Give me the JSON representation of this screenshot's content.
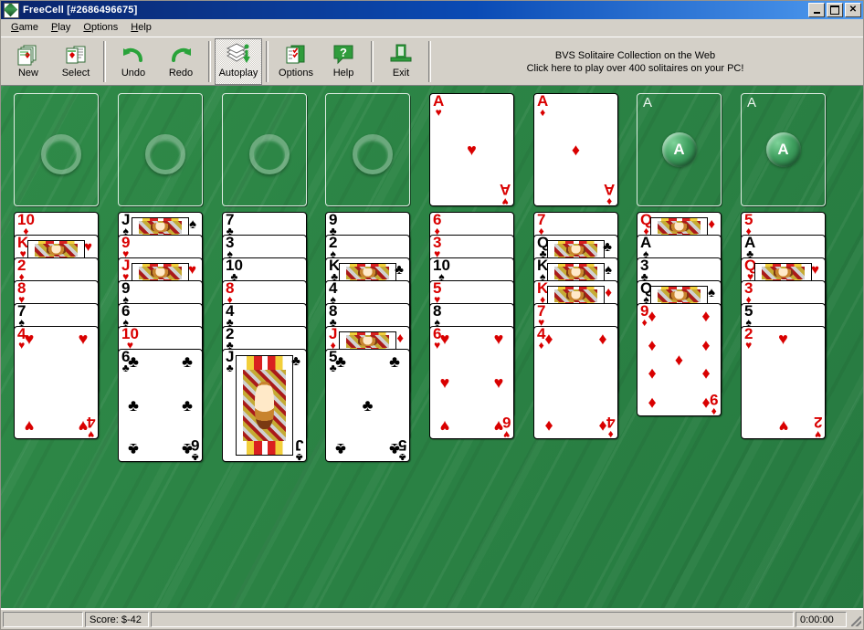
{
  "window": {
    "title": "FreeCell [#2686496675]",
    "icon": "cards-icon",
    "buttons": {
      "minimize": "minimize-icon",
      "maximize": "maximize-icon",
      "close": "✕"
    }
  },
  "menu": {
    "items": [
      "Game",
      "Play",
      "Options",
      "Help"
    ]
  },
  "toolbar": {
    "buttons": [
      {
        "label": "New",
        "icon": "new-game-icon",
        "active": false
      },
      {
        "label": "Select",
        "icon": "select-game-icon",
        "active": false
      },
      {
        "label": "Undo",
        "icon": "undo-icon",
        "active": false
      },
      {
        "label": "Redo",
        "icon": "redo-icon",
        "active": false
      },
      {
        "label": "Autoplay",
        "icon": "autoplay-icon",
        "active": true
      },
      {
        "label": "Options",
        "icon": "options-icon",
        "active": false
      },
      {
        "label": "Help",
        "icon": "help-icon",
        "active": false
      },
      {
        "label": "Exit",
        "icon": "exit-icon",
        "active": false
      }
    ],
    "ad_line1": "BVS Solitaire Collection on the Web",
    "ad_line2": "Click here to play over 400 solitaires on your PC!"
  },
  "board": {
    "background_color": "#2f8a48",
    "free_cells": [
      {
        "empty": true,
        "placeholder": "ring"
      },
      {
        "empty": true,
        "placeholder": "ring"
      },
      {
        "empty": true,
        "placeholder": "ring"
      },
      {
        "empty": true,
        "placeholder": "ring"
      },
      {
        "empty": false,
        "rank": "A",
        "suit": "♥",
        "color": "red"
      },
      {
        "empty": false,
        "rank": "A",
        "suit": "♦",
        "color": "red"
      }
    ],
    "foundations": [
      {
        "empty": true,
        "corner_label": "A",
        "orb_label": "A"
      },
      {
        "empty": true,
        "corner_label": "A",
        "orb_label": "A"
      }
    ],
    "tableau": [
      [
        {
          "rank": "10",
          "suit": "♦",
          "color": "red"
        },
        {
          "rank": "K",
          "suit": "♥",
          "color": "red",
          "court": true
        },
        {
          "rank": "2",
          "suit": "♦",
          "color": "red"
        },
        {
          "rank": "8",
          "suit": "♥",
          "color": "red"
        },
        {
          "rank": "7",
          "suit": "♠",
          "color": "black"
        },
        {
          "rank": "4",
          "suit": "♥",
          "color": "red"
        }
      ],
      [
        {
          "rank": "J",
          "suit": "♠",
          "color": "black",
          "court": true
        },
        {
          "rank": "9",
          "suit": "♥",
          "color": "red"
        },
        {
          "rank": "J",
          "suit": "♥",
          "color": "red",
          "court": true
        },
        {
          "rank": "9",
          "suit": "♠",
          "color": "black"
        },
        {
          "rank": "6",
          "suit": "♠",
          "color": "black"
        },
        {
          "rank": "10",
          "suit": "♥",
          "color": "red"
        },
        {
          "rank": "6",
          "suit": "♣",
          "color": "black"
        }
      ],
      [
        {
          "rank": "7",
          "suit": "♣",
          "color": "black"
        },
        {
          "rank": "3",
          "suit": "♠",
          "color": "black"
        },
        {
          "rank": "10",
          "suit": "♣",
          "color": "black"
        },
        {
          "rank": "8",
          "suit": "♦",
          "color": "red"
        },
        {
          "rank": "4",
          "suit": "♣",
          "color": "black"
        },
        {
          "rank": "2",
          "suit": "♣",
          "color": "black"
        },
        {
          "rank": "J",
          "suit": "♣",
          "color": "black",
          "court": true
        }
      ],
      [
        {
          "rank": "9",
          "suit": "♣",
          "color": "black"
        },
        {
          "rank": "2",
          "suit": "♠",
          "color": "black"
        },
        {
          "rank": "K",
          "suit": "♣",
          "color": "black",
          "court": true
        },
        {
          "rank": "4",
          "suit": "♠",
          "color": "black"
        },
        {
          "rank": "8",
          "suit": "♣",
          "color": "black"
        },
        {
          "rank": "J",
          "suit": "♦",
          "color": "red",
          "court": true
        },
        {
          "rank": "5",
          "suit": "♣",
          "color": "black"
        }
      ],
      [
        {
          "rank": "6",
          "suit": "♦",
          "color": "red"
        },
        {
          "rank": "3",
          "suit": "♥",
          "color": "red"
        },
        {
          "rank": "10",
          "suit": "♠",
          "color": "black"
        },
        {
          "rank": "5",
          "suit": "♥",
          "color": "red"
        },
        {
          "rank": "8",
          "suit": "♠",
          "color": "black"
        },
        {
          "rank": "6",
          "suit": "♥",
          "color": "red"
        }
      ],
      [
        {
          "rank": "7",
          "suit": "♦",
          "color": "red"
        },
        {
          "rank": "Q",
          "suit": "♣",
          "color": "black",
          "court": true
        },
        {
          "rank": "K",
          "suit": "♠",
          "color": "black",
          "court": true
        },
        {
          "rank": "K",
          "suit": "♦",
          "color": "red",
          "court": true
        },
        {
          "rank": "7",
          "suit": "♥",
          "color": "red"
        },
        {
          "rank": "4",
          "suit": "♦",
          "color": "red"
        }
      ],
      [
        {
          "rank": "Q",
          "suit": "♦",
          "color": "red",
          "court": true
        },
        {
          "rank": "A",
          "suit": "♠",
          "color": "black"
        },
        {
          "rank": "3",
          "suit": "♣",
          "color": "black"
        },
        {
          "rank": "Q",
          "suit": "♠",
          "color": "black",
          "court": true
        },
        {
          "rank": "9",
          "suit": "♦",
          "color": "red"
        }
      ],
      [
        {
          "rank": "5",
          "suit": "♦",
          "color": "red"
        },
        {
          "rank": "A",
          "suit": "♣",
          "color": "black"
        },
        {
          "rank": "Q",
          "suit": "♥",
          "color": "red",
          "court": true
        },
        {
          "rank": "3",
          "suit": "♦",
          "color": "red"
        },
        {
          "rank": "5",
          "suit": "♠",
          "color": "black"
        },
        {
          "rank": "2",
          "suit": "♥",
          "color": "red"
        }
      ]
    ]
  },
  "statusbar": {
    "blank_left": "",
    "score": "Score: $-42",
    "message": "",
    "time": "0:00:00"
  }
}
